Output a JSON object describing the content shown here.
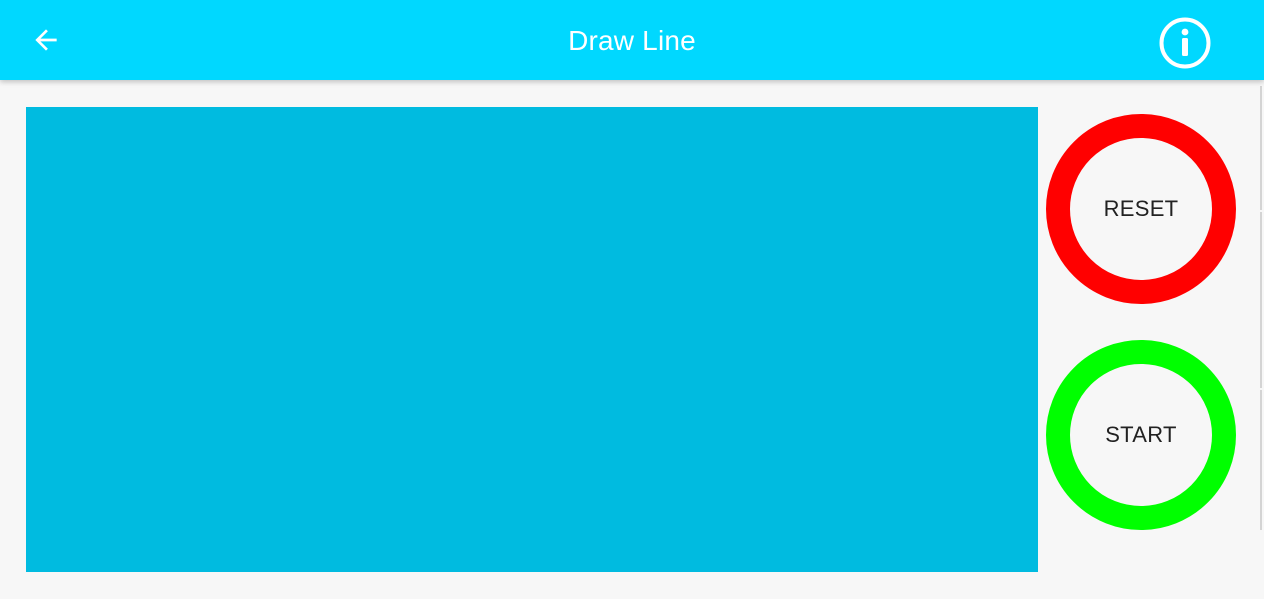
{
  "app_bar": {
    "title": "Draw Line",
    "back_icon": "arrow-left-icon",
    "info_icon": "info-circle-icon"
  },
  "canvas": {
    "color": "#00bbe0"
  },
  "controls": {
    "reset": {
      "label": "RESET",
      "ring_color": "#ff0000"
    },
    "start": {
      "label": "START",
      "ring_color": "#00ff00"
    }
  },
  "colors": {
    "app_bar": "#00d8ff",
    "background": "#f7f7f7",
    "title_text": "#ffffff",
    "button_text": "#222222"
  }
}
